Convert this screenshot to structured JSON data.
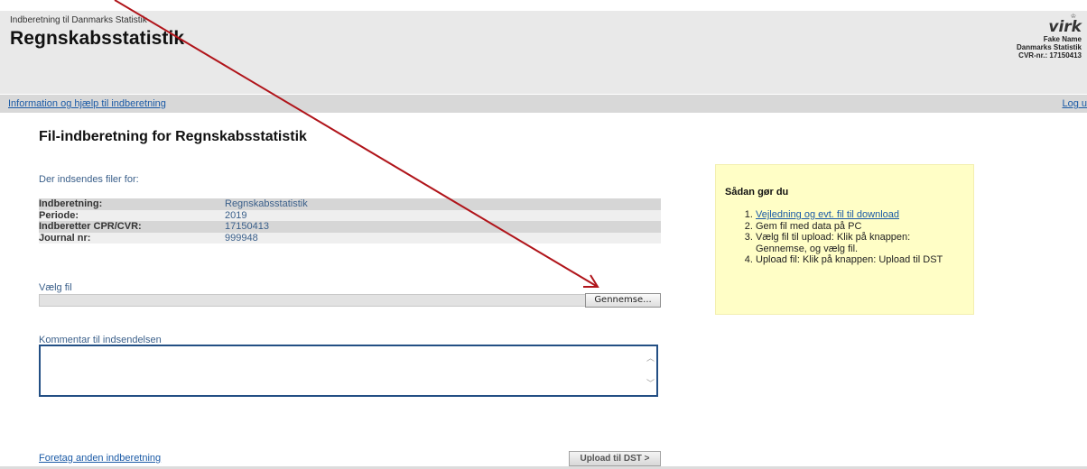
{
  "header": {
    "subtitle": "Indberetning til Danmarks Statistik",
    "title": "Regnskabsstatistik",
    "brand": "virk",
    "user_name": "Fake Name",
    "org": "Danmarks Statistik",
    "cvr": "CVR-nr.: 17150413"
  },
  "nav": {
    "help_link": "Information og hjælp til indberetning",
    "logout": "Log u"
  },
  "page": {
    "title": "Fil-indberetning for Regnskabsstatistik",
    "intro": "Der indsendes filer for:"
  },
  "info": [
    {
      "label": "Indberetning:",
      "value": "Regnskabsstatistik"
    },
    {
      "label": "Periode:",
      "value": "2019"
    },
    {
      "label": "Indberetter CPR/CVR:",
      "value": "17150413"
    },
    {
      "label": "Journal nr:",
      "value": "999948"
    }
  ],
  "file": {
    "label": "Vælg fil",
    "browse": "Gennemse..."
  },
  "comment": {
    "label": "Kommentar til indsendelsen",
    "value": ""
  },
  "footer": {
    "other_link": "Foretag anden indberetning",
    "upload": "Upload til DST >"
  },
  "help": {
    "title": "Sådan gør du",
    "steps": [
      "Vejledning og evt. fil til download",
      "Gem fil med data på PC",
      "Vælg fil til upload: Klik på knappen: Gennemse, og vælg fil.",
      "Upload fil: Klik på knappen: Upload til DST"
    ]
  },
  "colors": {
    "header_bg": "#e9e9e9",
    "nav_bg": "#d8d8d8",
    "link": "#1a5aa6",
    "help_bg": "#fffec6",
    "arrow": "#b0141a"
  }
}
